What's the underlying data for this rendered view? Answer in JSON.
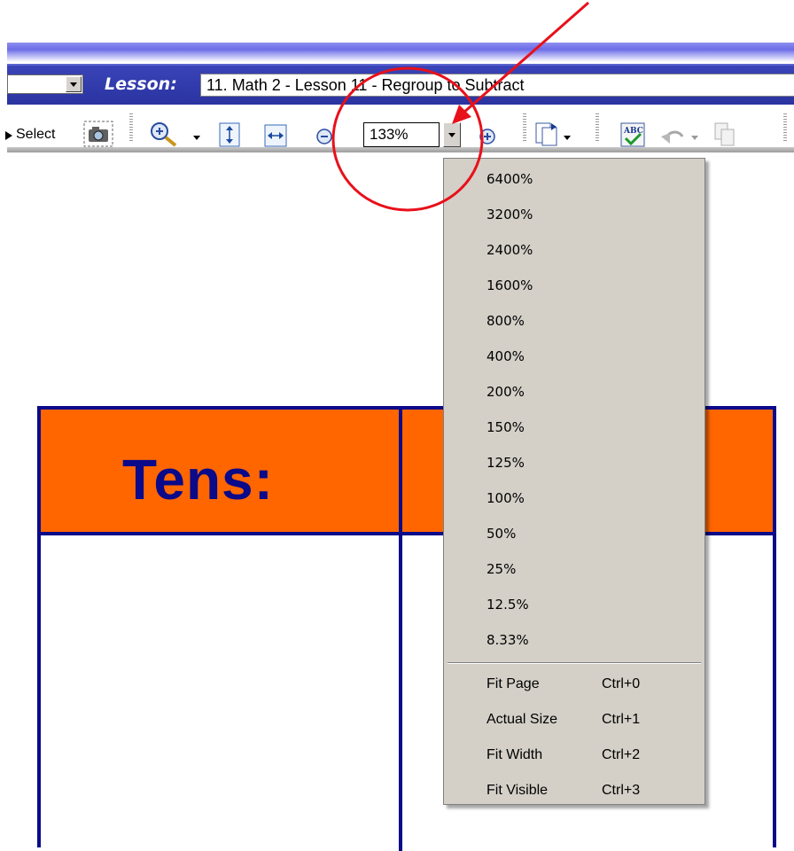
{
  "lesson_bar": {
    "label": "Lesson:",
    "value": "11. Math 2 - Lesson 11 - Regroup to Subtract"
  },
  "toolbar": {
    "select_label": "Select",
    "zoom_value": "133%"
  },
  "document": {
    "header_text": "Tens:"
  },
  "zoom_menu": {
    "percent_items": [
      "6400%",
      "3200%",
      "2400%",
      "1600%",
      "800%",
      "400%",
      "200%",
      "150%",
      "125%",
      "100%",
      "50%",
      "25%",
      "12.5%",
      "8.33%"
    ],
    "commands": [
      {
        "label": "Fit Page",
        "shortcut": "Ctrl+0"
      },
      {
        "label": "Actual Size",
        "shortcut": "Ctrl+1"
      },
      {
        "label": "Fit Width",
        "shortcut": "Ctrl+2"
      },
      {
        "label": "Fit Visible",
        "shortcut": "Ctrl+3"
      }
    ]
  },
  "annotation": {
    "color": "#e8101a"
  },
  "colors": {
    "table_border": "#0a0a8a",
    "header_fill": "#ff6600",
    "menu_bg": "#d4d0c8"
  }
}
